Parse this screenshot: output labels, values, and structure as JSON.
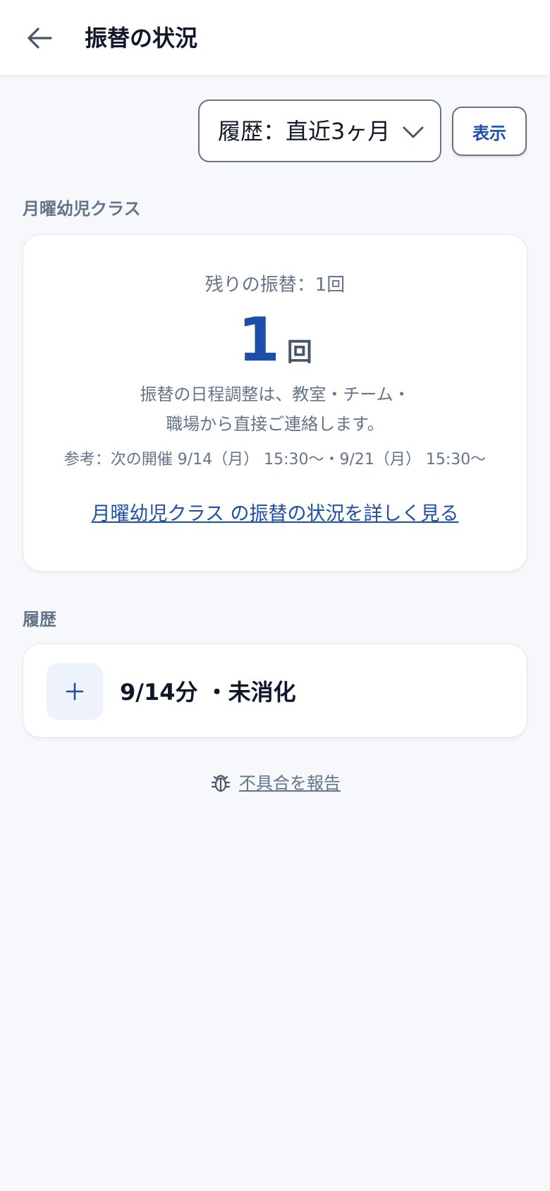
{
  "header": {
    "title": "振替の状況",
    "back_icon": "arrow-left-icon"
  },
  "filter": {
    "period_selected": "履歴：直近3ヶ月",
    "dropdown_icon": "chevron-down-icon",
    "show_label": "表示"
  },
  "class_section": {
    "label": "月曜幼児クラス",
    "remaining_label": "残りの振替：1回",
    "count": "1",
    "unit": "回",
    "note_line1": "振替の日程調整は、教室・チーム・",
    "note_line2": "職場から直接ご連絡します。",
    "schedule": "参考：次の開催 9/14（月） 15:30〜・9/21（月） 15:30〜",
    "detail_link": "月曜幼児クラス の振替の状況を詳しく見る"
  },
  "history": {
    "label": "履歴",
    "items": [
      {
        "title": "9/14分 ・未消化",
        "expand_icon": "plus-icon"
      }
    ]
  },
  "footer": {
    "report_icon": "bug-icon",
    "report_label": "不具合を報告"
  },
  "colors": {
    "accent": "#1e4fa8",
    "muted_text": "#64748b",
    "background": "#f6f8fb",
    "expand_bg": "#eef3fb"
  }
}
